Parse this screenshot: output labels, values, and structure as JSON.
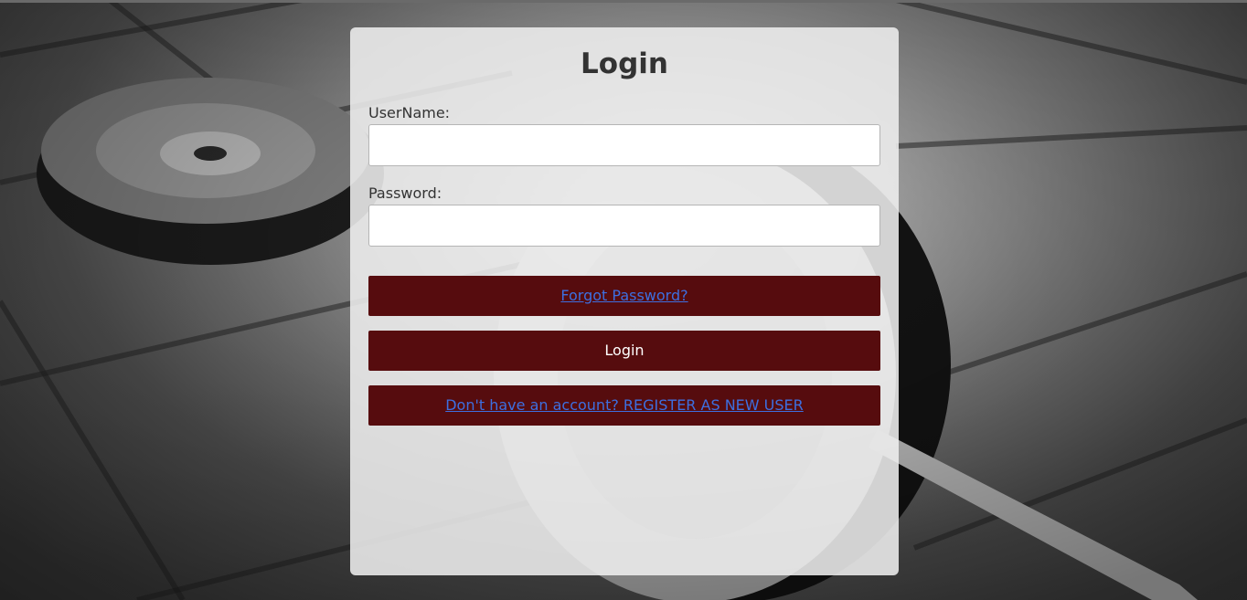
{
  "colors": {
    "bar_background": "#560c0e",
    "link_color": "#3d6fe0",
    "card_background": "#eeeeee",
    "title_color": "#333333"
  },
  "login_form": {
    "title": "Login",
    "username_label": "UserName:",
    "username_value": "",
    "password_label": "Password:",
    "password_value": "",
    "forgot_password_link": "Forgot Password?",
    "login_button": "Login",
    "register_link": "Don't have an account? REGISTER AS NEW USER"
  }
}
